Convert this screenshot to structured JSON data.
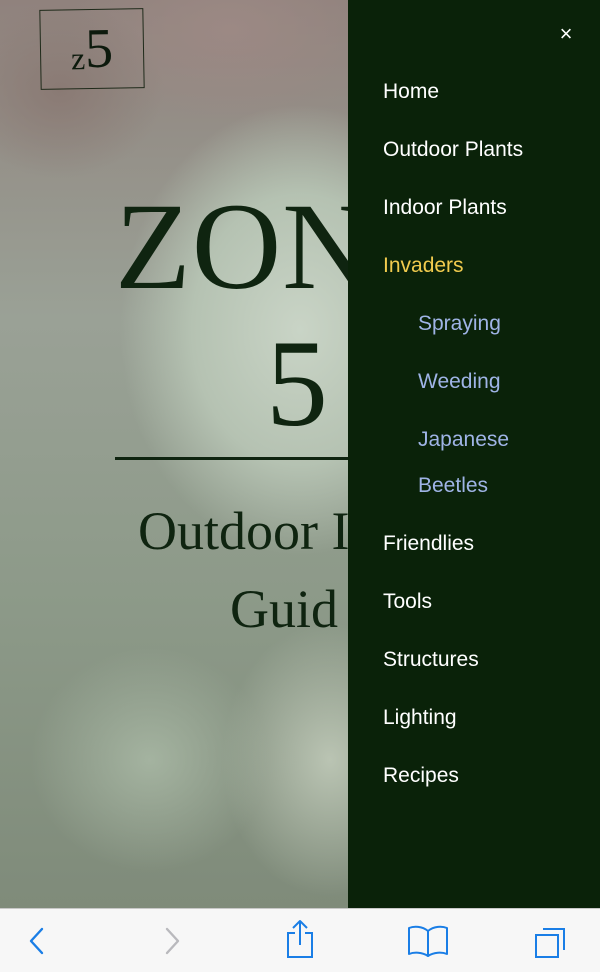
{
  "hero": {
    "logo_letter": "z",
    "logo_number": "5",
    "title": "ZON",
    "title_number": "5",
    "subtitle_line1": "Outdoor I",
    "subtitle_line2": "Guid"
  },
  "drawer": {
    "close_label": "×",
    "items": [
      {
        "label": "Home",
        "active": false
      },
      {
        "label": "Outdoor Plants",
        "active": false
      },
      {
        "label": "Indoor Plants",
        "active": false
      },
      {
        "label": "Invaders",
        "active": true
      },
      {
        "label": "Friendlies",
        "active": false
      },
      {
        "label": "Tools",
        "active": false
      },
      {
        "label": "Structures",
        "active": false
      },
      {
        "label": "Lighting",
        "active": false
      },
      {
        "label": "Recipes",
        "active": false
      }
    ],
    "subitems": [
      {
        "label": "Spraying"
      },
      {
        "label": "Weeding"
      },
      {
        "label": "Japanese Beetles"
      }
    ],
    "colors": {
      "background": "#0a2209",
      "active": "#f1cb4e",
      "subitem": "#9fb4e6",
      "text": "#ffffff"
    }
  },
  "toolbar": {
    "icons": [
      "back-icon",
      "forward-icon",
      "share-icon",
      "bookmarks-icon",
      "tabs-icon"
    ],
    "accent": "#1a7ee6"
  }
}
